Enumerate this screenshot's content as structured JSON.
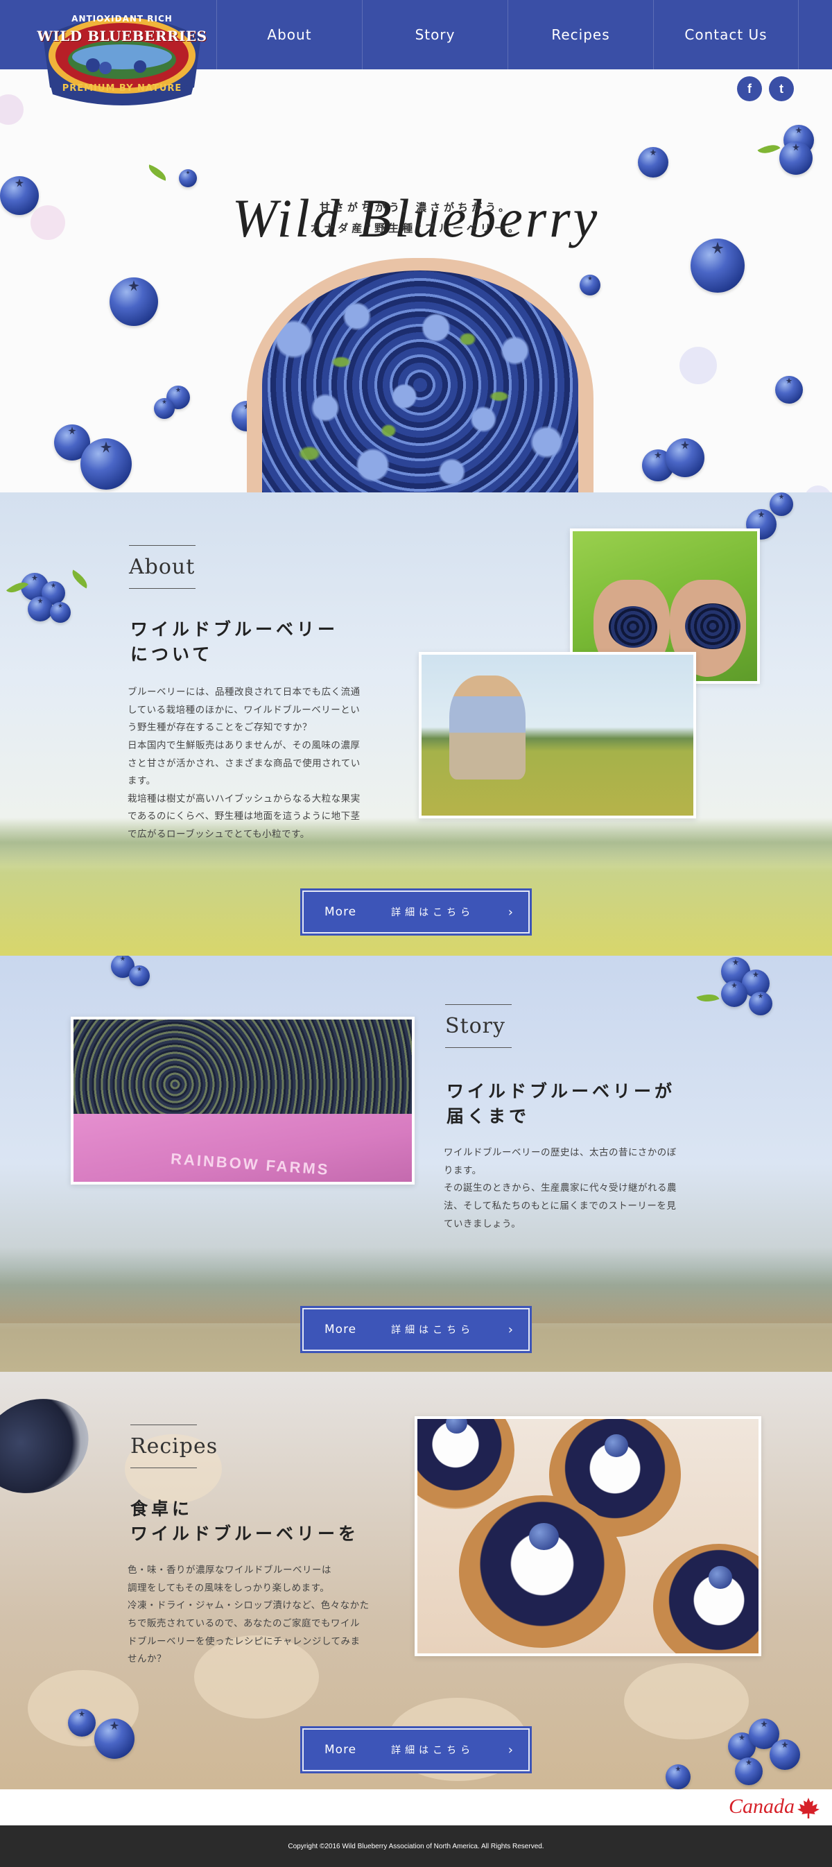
{
  "nav": {
    "items": [
      {
        "label": "About"
      },
      {
        "label": "Story"
      },
      {
        "label": "Recipes"
      },
      {
        "label": "Contact Us"
      }
    ]
  },
  "logo": {
    "top_text": "ANTIOXIDANT RICH",
    "name": "WILD BLUEBERRIES",
    "bottom_text": "PREMIUM BY NATURE"
  },
  "social": {
    "facebook": "f",
    "twitter": "t"
  },
  "hero": {
    "title": "Wild Blueberry",
    "line1": "甘さがちがう。濃さがちがう。",
    "line2": "カナダ産\"野生種\"ブルーベリー。"
  },
  "about": {
    "eyebrow": "About",
    "heading_line1": "ワイルドブルーベリー",
    "heading_line2": "について",
    "body": [
      "ブルーベリーには、品種改良されて日本でも広く流通",
      "している栽培種のほかに、ワイルドブルーベリーとい",
      "う野生種が存在することをご存知ですか？",
      "日本国内で生鮮販売はありませんが、その風味の濃厚",
      "さと甘さが活かされ、さまざまな商品で使用されてい",
      "ます。",
      "栽培種は樹丈が高いハイブッシュからなる大粒な果実",
      "であるのにくらべ、野生種は地面を這うように地下茎",
      "で広がるローブッシュでとても小粒です。"
    ],
    "button": {
      "en": "More",
      "jp": "詳細はこちら",
      "arrow": "›"
    }
  },
  "story": {
    "eyebrow": "Story",
    "heading_line1": "ワイルドブルーベリーが",
    "heading_line2": "届くまで",
    "body": [
      "ワイルドブルーベリーの歴史は、太古の昔にさかのぼ",
      "ります。",
      "その誕生のときから、生産農家に代々受け継がれる農",
      "法、そして私たちのもとに届くまでのストーリーを見",
      "ていきましょう。"
    ],
    "photo_label": "RAINBOW FARMS",
    "button": {
      "en": "More",
      "jp": "詳細はこちら",
      "arrow": "›"
    }
  },
  "recipes": {
    "eyebrow": "Recipes",
    "heading_line1": "食卓に",
    "heading_line2": "ワイルドブルーベリーを",
    "body": [
      "色・味・香りが濃厚なワイルドブルーベリーは",
      "調理をしてもその風味をしっかり楽しめます。",
      "冷凍・ドライ・ジャム・シロップ漬けなど、色々なかた",
      "ちで販売されているので、あなたのご家庭でもワイル",
      "ドブルーベリーを使ったレシピにチャレンジしてみま",
      "せんか？"
    ],
    "button": {
      "en": "More",
      "jp": "詳細はこちら",
      "arrow": "›"
    }
  },
  "footer": {
    "canada": "Canada",
    "copyright": "Copyright ©2016 Wild Blueberry Association of North America. All Rights Reserved."
  },
  "colors": {
    "nav_bg": "#3a4fa6",
    "button_bg": "#3d55b8",
    "footer_bg": "#2b2b2b",
    "canada_red": "#d62028"
  }
}
